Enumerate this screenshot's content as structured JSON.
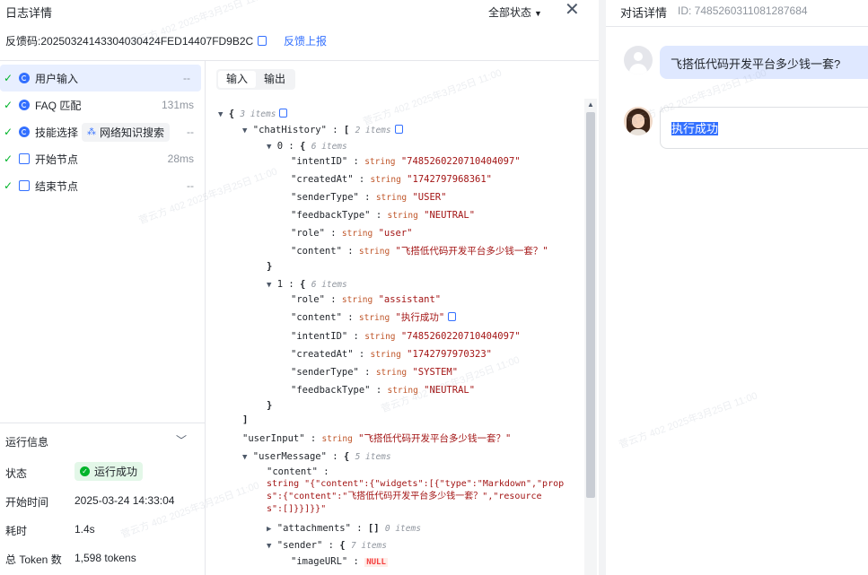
{
  "header": {
    "title": "日志详情",
    "filter_label": "全部状态",
    "feedback_code_label": "反馈码:",
    "feedback_code": "20250324143304030424FED14407FD9B2C",
    "feedback_link": "反馈上报"
  },
  "nodes": [
    {
      "label": "用户输入",
      "time": "--"
    },
    {
      "label": "FAQ 匹配",
      "time": "131ms"
    },
    {
      "label": "技能选择",
      "badge": "网络知识搜索",
      "time": "--"
    },
    {
      "label": "开始节点",
      "time": "28ms"
    },
    {
      "label": "结束节点",
      "time": "--"
    }
  ],
  "run_info": {
    "title": "运行信息",
    "status_label": "状态",
    "status_value": "运行成功",
    "start_label": "开始时间",
    "start_value": "2025-03-24 14:33:04",
    "duration_label": "耗时",
    "duration_value": "1.4s",
    "token_label": "总 Token 数",
    "token_value": "1,598 tokens"
  },
  "tabs": {
    "input": "输入",
    "output": "输出"
  },
  "json": {
    "root_count": "3 items",
    "chat_history_key": "\"chatHistory\"",
    "chat_history_count": "2 items",
    "item0_count": "6 items",
    "item0": [
      {
        "k": "\"intentID\"",
        "t": "string",
        "v": "\"7485260220710404097\""
      },
      {
        "k": "\"createdAt\"",
        "t": "string",
        "v": "\"1742797968361\""
      },
      {
        "k": "\"senderType\"",
        "t": "string",
        "v": "\"USER\""
      },
      {
        "k": "\"feedbackType\"",
        "t": "string",
        "v": "\"NEUTRAL\""
      },
      {
        "k": "\"role\"",
        "t": "string",
        "v": "\"user\""
      },
      {
        "k": "\"content\"",
        "t": "string",
        "v": "\"飞搭低代码开发平台多少钱一套？\""
      }
    ],
    "item1_count": "6 items",
    "item1": [
      {
        "k": "\"role\"",
        "t": "string",
        "v": "\"assistant\""
      },
      {
        "k": "\"content\"",
        "t": "string",
        "v": "\"执行成功\""
      },
      {
        "k": "\"intentID\"",
        "t": "string",
        "v": "\"7485260220710404097\""
      },
      {
        "k": "\"createdAt\"",
        "t": "string",
        "v": "\"1742797970323\""
      },
      {
        "k": "\"senderType\"",
        "t": "string",
        "v": "\"SYSTEM\""
      },
      {
        "k": "\"feedbackType\"",
        "t": "string",
        "v": "\"NEUTRAL\""
      }
    ],
    "user_input_key": "\"userInput\"",
    "user_input_type": "string",
    "user_input_value": "\"飞搭低代码开发平台多少钱一套？\"",
    "user_message_key": "\"userMessage\"",
    "user_message_count": "5 items",
    "content_key": "\"content\"",
    "content_line1": "string \"{\"content\":{\"widgets\":[{\"type\":\"Markdown\",\"prop",
    "content_line2": "s\":{\"content\":\"飞搭低代码开发平台多少钱一套？\",\"resource",
    "content_line3": "s\":[]}}]}}\"",
    "attachments_key": "\"attachments\"",
    "attachments_count": "0 items",
    "sender_key": "\"sender\"",
    "sender_count": "7 items",
    "image_url_key": "\"imageURL\"",
    "null_label": "NULL"
  },
  "watermark": "菅云方 402 2025年3月25日 11:00",
  "chat": {
    "title": "对话详情",
    "id": "ID: 7485260311081287684",
    "user_message": "飞搭低代码开发平台多少钱一套?",
    "bot_message": "执行成功"
  },
  "colors": {
    "accent": "#3370ff",
    "success": "#00b42a",
    "string": "#a31515",
    "type": "#c0572b"
  }
}
